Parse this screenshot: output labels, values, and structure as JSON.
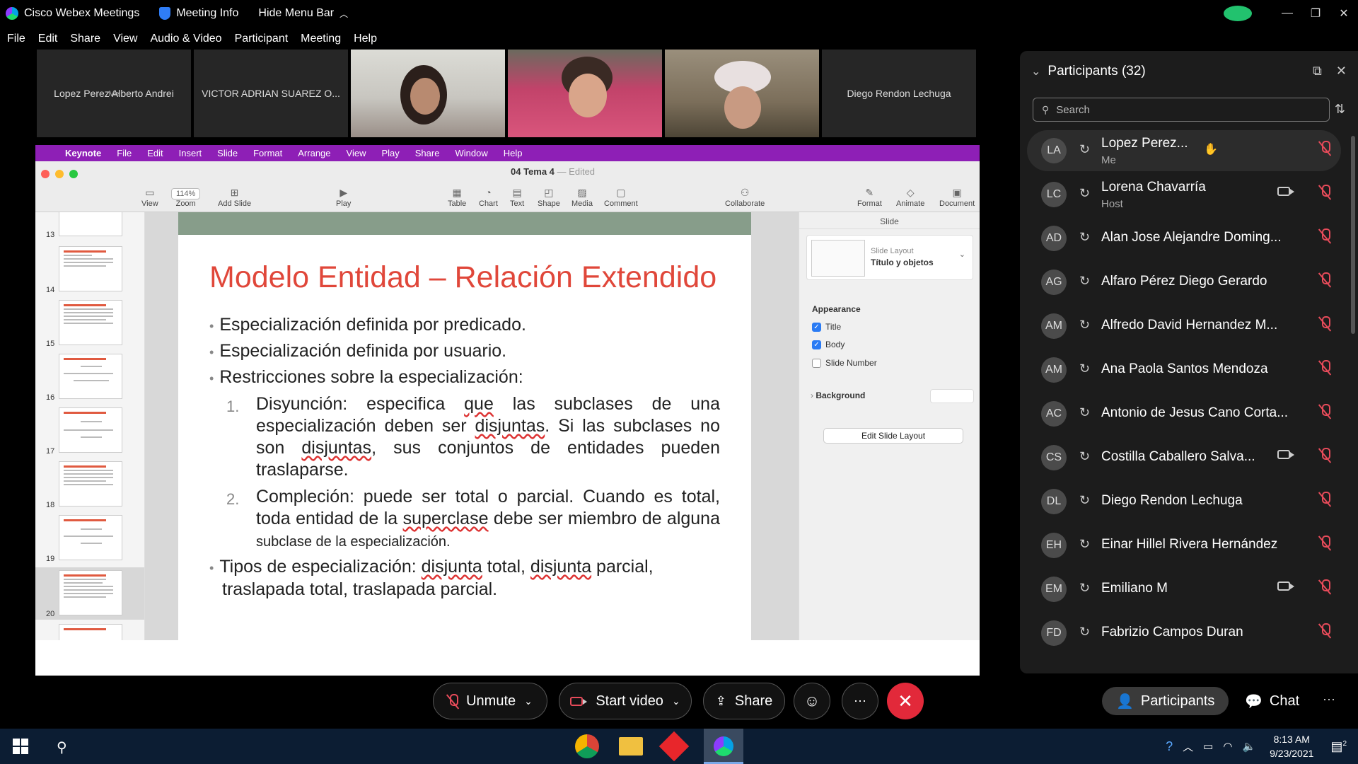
{
  "titlebar": {
    "app_name": "Cisco Webex Meetings",
    "meeting_info": "Meeting Info",
    "hide_menu": "Hide Menu Bar"
  },
  "menubar": [
    "File",
    "Edit",
    "Share",
    "View",
    "Audio & Video",
    "Participant",
    "Meeting",
    "Help"
  ],
  "video_strip": [
    {
      "name": "Lopez Perez Alberto Andrei",
      "sub": "Me"
    },
    {
      "name": "VICTOR ADRIAN SUAREZ O...",
      "sub": ""
    },
    {
      "name": "Diego Rendon Lechuga",
      "sub": ""
    }
  ],
  "keynote": {
    "menu": [
      "Keynote",
      "File",
      "Edit",
      "Insert",
      "Slide",
      "Format",
      "Arrange",
      "View",
      "Play",
      "Share",
      "Window",
      "Help"
    ],
    "doc_title": "04 Tema 4",
    "doc_status": "Edited",
    "zoom": "114%",
    "toolbar": [
      "View",
      "Zoom",
      "Add Slide",
      "Play",
      "Table",
      "Chart",
      "Text",
      "Shape",
      "Media",
      "Comment",
      "Collaborate",
      "Format",
      "Animate",
      "Document"
    ],
    "slide_numbers": [
      "13",
      "14",
      "15",
      "16",
      "17",
      "18",
      "19",
      "20"
    ],
    "slide": {
      "title": "Modelo Entidad – Relación Extendido",
      "b1": "Especialización definida por predicado.",
      "b2": "Especialización definida por usuario.",
      "b3": "Restricciones sobre la especialización:",
      "n1": "1.",
      "s1_a": "Disyunción: especifica ",
      "s1_u1": "que",
      "s1_b": " las subclases de una especialización deben ser ",
      "s1_u2": "disjuntas",
      "s1_c": ". Si las subclases no son ",
      "s1_u3": "disjuntas",
      "s1_d": ", sus conjuntos de entidades pueden traslaparse.",
      "n2": "2.",
      "s2_a": "Compleción: puede ser total o parcial. Cuando es total, toda entidad de la ",
      "s2_u1": "superclase",
      "s2_b": " debe ser miembro de alguna ",
      "s2_small": "subclase de la especialización.",
      "b4_a": "Tipos de especialización: ",
      "b4_u1": "disjunta",
      "b4_b": " total, ",
      "b4_u2": "disjunta",
      "b4_c": " parcial,",
      "b4_line2": "traslapada total, traslapada parcial."
    },
    "inspector": {
      "header": "Slide",
      "layout_label": "Slide Layout",
      "layout_value": "Título y objetos",
      "appearance": "Appearance",
      "title_chk": "Title",
      "body_chk": "Body",
      "slidenum_chk": "Slide Number",
      "background": "Background",
      "edit_btn": "Edit Slide Layout"
    }
  },
  "participants": {
    "header": "Participants (32)",
    "search_placeholder": "Search",
    "list": [
      {
        "initials": "LA",
        "name": "Lopez Perez...",
        "role": "Me"
      },
      {
        "initials": "LC",
        "name": "Lorena Chavarría",
        "role": "Host"
      },
      {
        "initials": "AD",
        "name": "Alan Jose Alejandre Doming...",
        "role": ""
      },
      {
        "initials": "AG",
        "name": "Alfaro Pérez Diego Gerardo",
        "role": ""
      },
      {
        "initials": "AM",
        "name": "Alfredo David Hernandez M...",
        "role": ""
      },
      {
        "initials": "AM",
        "name": "Ana Paola Santos Mendoza",
        "role": ""
      },
      {
        "initials": "AC",
        "name": "Antonio de Jesus Cano Corta...",
        "role": ""
      },
      {
        "initials": "CS",
        "name": "Costilla Caballero Salva...",
        "role": ""
      },
      {
        "initials": "DL",
        "name": "Diego Rendon Lechuga",
        "role": ""
      },
      {
        "initials": "EH",
        "name": "Einar Hillel Rivera Hernández",
        "role": ""
      },
      {
        "initials": "EM",
        "name": "Emiliano M",
        "role": ""
      },
      {
        "initials": "FD",
        "name": "Fabrizio Campos Duran",
        "role": ""
      }
    ]
  },
  "controls": {
    "unmute": "Unmute",
    "start_video": "Start video",
    "share": "Share",
    "participants": "Participants",
    "chat": "Chat"
  },
  "taskbar": {
    "time": "8:13 AM",
    "date": "9/23/2021",
    "notif_count": "2"
  },
  "colors": {
    "keynote_menubar": "#8e1fb6",
    "slide_title": "#e0473a",
    "leave_button": "#e2293a",
    "mic_muted": "#e74b5a"
  }
}
